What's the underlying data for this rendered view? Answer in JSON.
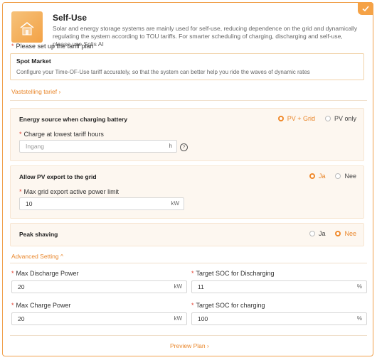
{
  "header": {
    "title": "Self-Use",
    "description": "Solar and energy storage systems are mainly used for self-use, reducing dependence on the grid and dynamically regulating the system according to TOU tariffs. For smarter scheduling of charging, discharging and self-use, please use Solis AI"
  },
  "tariff": {
    "label": "Please set up the tariff plan",
    "box_title": "Spot Market",
    "box_desc": "Configure your Time-OF-Use tariff accurately, so that the system can better help you ride the waves of dynamic rates",
    "link": "Vaststelling tarief",
    "link_chevron": "›"
  },
  "charging": {
    "title": "Energy source when charging battery",
    "options": [
      "PV + Grid",
      "PV only"
    ],
    "selected": "PV + Grid",
    "field_label": "Charge at lowest tariff hours",
    "field_placeholder": "Ingang",
    "field_unit": "h",
    "help_icon": "?"
  },
  "export": {
    "title": "Allow PV export to the grid",
    "options": [
      "Ja",
      "Nee"
    ],
    "selected": "Ja",
    "field_label": "Max grid export active power limit",
    "field_value": "10",
    "field_unit": "kW"
  },
  "peak": {
    "title": "Peak shaving",
    "options": [
      "Ja",
      "Nee"
    ],
    "selected": "Nee"
  },
  "advanced": {
    "label": "Advanced Setting",
    "chevron": "^",
    "max_discharge": {
      "label": "Max Discharge Power",
      "value": "20",
      "unit": "kW"
    },
    "target_soc_discharge": {
      "label": "Target SOC for Discharging",
      "value": "11",
      "unit": "%"
    },
    "max_charge": {
      "label": "Max Charge Power",
      "value": "20",
      "unit": "kW"
    },
    "target_soc_charge": {
      "label": "Target SOC for charging",
      "value": "100",
      "unit": "%"
    }
  },
  "footer": {
    "preview": "Preview Plan",
    "chevron": "›"
  },
  "colors": {
    "accent": "#f08a2c",
    "required": "#e23c2c"
  },
  "icons": {
    "corner": "check-icon",
    "header": "house-icon"
  }
}
